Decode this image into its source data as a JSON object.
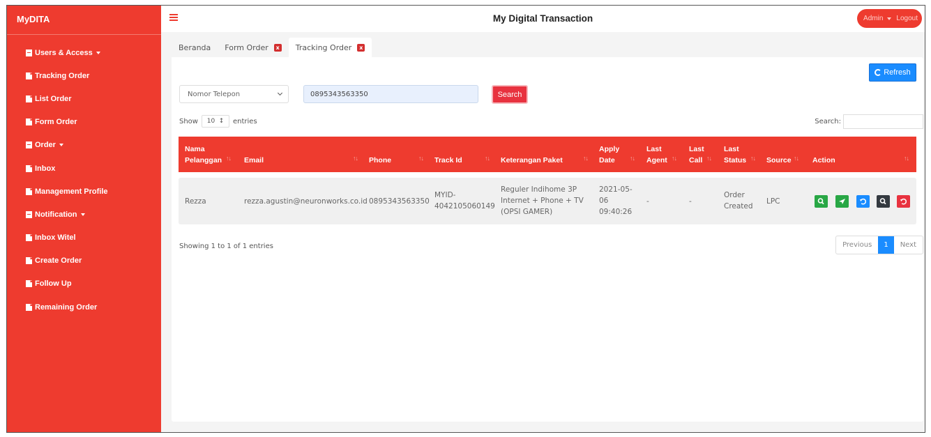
{
  "brand": "MyDITA",
  "app_title": "My Digital Transaction",
  "user": {
    "name": "Admin",
    "logout": "Logout"
  },
  "sidebar": {
    "items": [
      {
        "label": "Users & Access",
        "icon": "grid-icon",
        "dropdown": true
      },
      {
        "label": "Tracking Order",
        "icon": "file-icon"
      },
      {
        "label": "List Order",
        "icon": "file-icon"
      },
      {
        "label": "Form Order",
        "icon": "file-icon"
      },
      {
        "label": "Order",
        "icon": "grid-icon",
        "dropdown": true
      },
      {
        "label": "Inbox",
        "icon": "file-icon"
      },
      {
        "label": "Management Profile",
        "icon": "file-icon"
      },
      {
        "label": "Notification",
        "icon": "grid-icon",
        "dropdown": true
      },
      {
        "label": "Inbox Witel",
        "icon": "file-icon"
      },
      {
        "label": "Create Order",
        "icon": "file-icon"
      },
      {
        "label": "Follow Up",
        "icon": "file-icon"
      },
      {
        "label": "Remaining Order",
        "icon": "file-icon"
      }
    ]
  },
  "tabs": [
    {
      "label": "Beranda",
      "closable": false,
      "active": false
    },
    {
      "label": "Form Order",
      "closable": true,
      "active": false
    },
    {
      "label": "Tracking Order",
      "closable": true,
      "active": true
    }
  ],
  "tab_close_glyph": "x",
  "toolbar": {
    "refresh_label": "Refresh",
    "filter_select_value": "Nomor Telepon",
    "search_value": "0895343563350",
    "search_button": "Search"
  },
  "table_controls": {
    "show_label": "Show",
    "length_value": "10",
    "entries_label": "entries",
    "search_label": "Search:"
  },
  "table": {
    "columns": [
      {
        "line1": "Nama",
        "line2": "Pelanggan"
      },
      {
        "line1": "",
        "line2": "Email"
      },
      {
        "line1": "",
        "line2": "Phone"
      },
      {
        "line1": "",
        "line2": "Track Id"
      },
      {
        "line1": "",
        "line2": "Keterangan Paket"
      },
      {
        "line1": "Apply",
        "line2": "Date"
      },
      {
        "line1": "Last",
        "line2": "Agent"
      },
      {
        "line1": "Last",
        "line2": "Call"
      },
      {
        "line1": "Last",
        "line2": "Status"
      },
      {
        "line1": "",
        "line2": "Source"
      },
      {
        "line1": "",
        "line2": "Action"
      }
    ],
    "rows": [
      {
        "nama": "Rezza",
        "email": "rezza.agustin@neuronworks.co.id",
        "phone": "0895343563350",
        "track_id_1": "MYID-",
        "track_id_2": "4042105060149",
        "paket_1": "Reguler Indihome 3P",
        "paket_2": "Internet + Phone + TV",
        "paket_3": "(OPSI GAMER)",
        "date_1": "2021-05-",
        "date_2": "06",
        "date_3": "09:40:26",
        "agent": "-",
        "call": "-",
        "status_1": "Order",
        "status_2": "Created",
        "source": "LPC"
      }
    ]
  },
  "action_colors": [
    "#28a745",
    "#28a745",
    "#1a8cff",
    "#343a40",
    "#e8323f"
  ],
  "footer": {
    "showing": "Showing 1 to 1 of 1 entries",
    "previous": "Previous",
    "current_page": "1",
    "next": "Next"
  },
  "colors": {
    "primary": "#ee3b2f",
    "accent": "#1a8cff"
  }
}
